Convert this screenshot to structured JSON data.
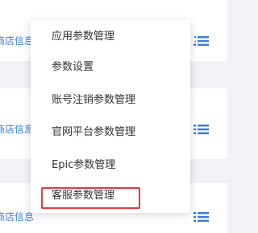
{
  "rows": [
    {
      "label": "商店信息"
    },
    {
      "label": "商店信息"
    },
    {
      "label": "商店信息"
    }
  ],
  "dropdown": {
    "items": [
      {
        "label": "应用参数管理"
      },
      {
        "label": "参数设置"
      },
      {
        "label": "账号注销参数管理"
      },
      {
        "label": "官网平台参数管理"
      },
      {
        "label": "Epic参数管理"
      },
      {
        "label": "客服参数管理",
        "highlighted": true
      }
    ]
  },
  "icons": {
    "row_action": "list-icon"
  },
  "colors": {
    "link": "#3b7ddd",
    "highlight": "#e4393c",
    "icon": "#3b7ddd"
  }
}
